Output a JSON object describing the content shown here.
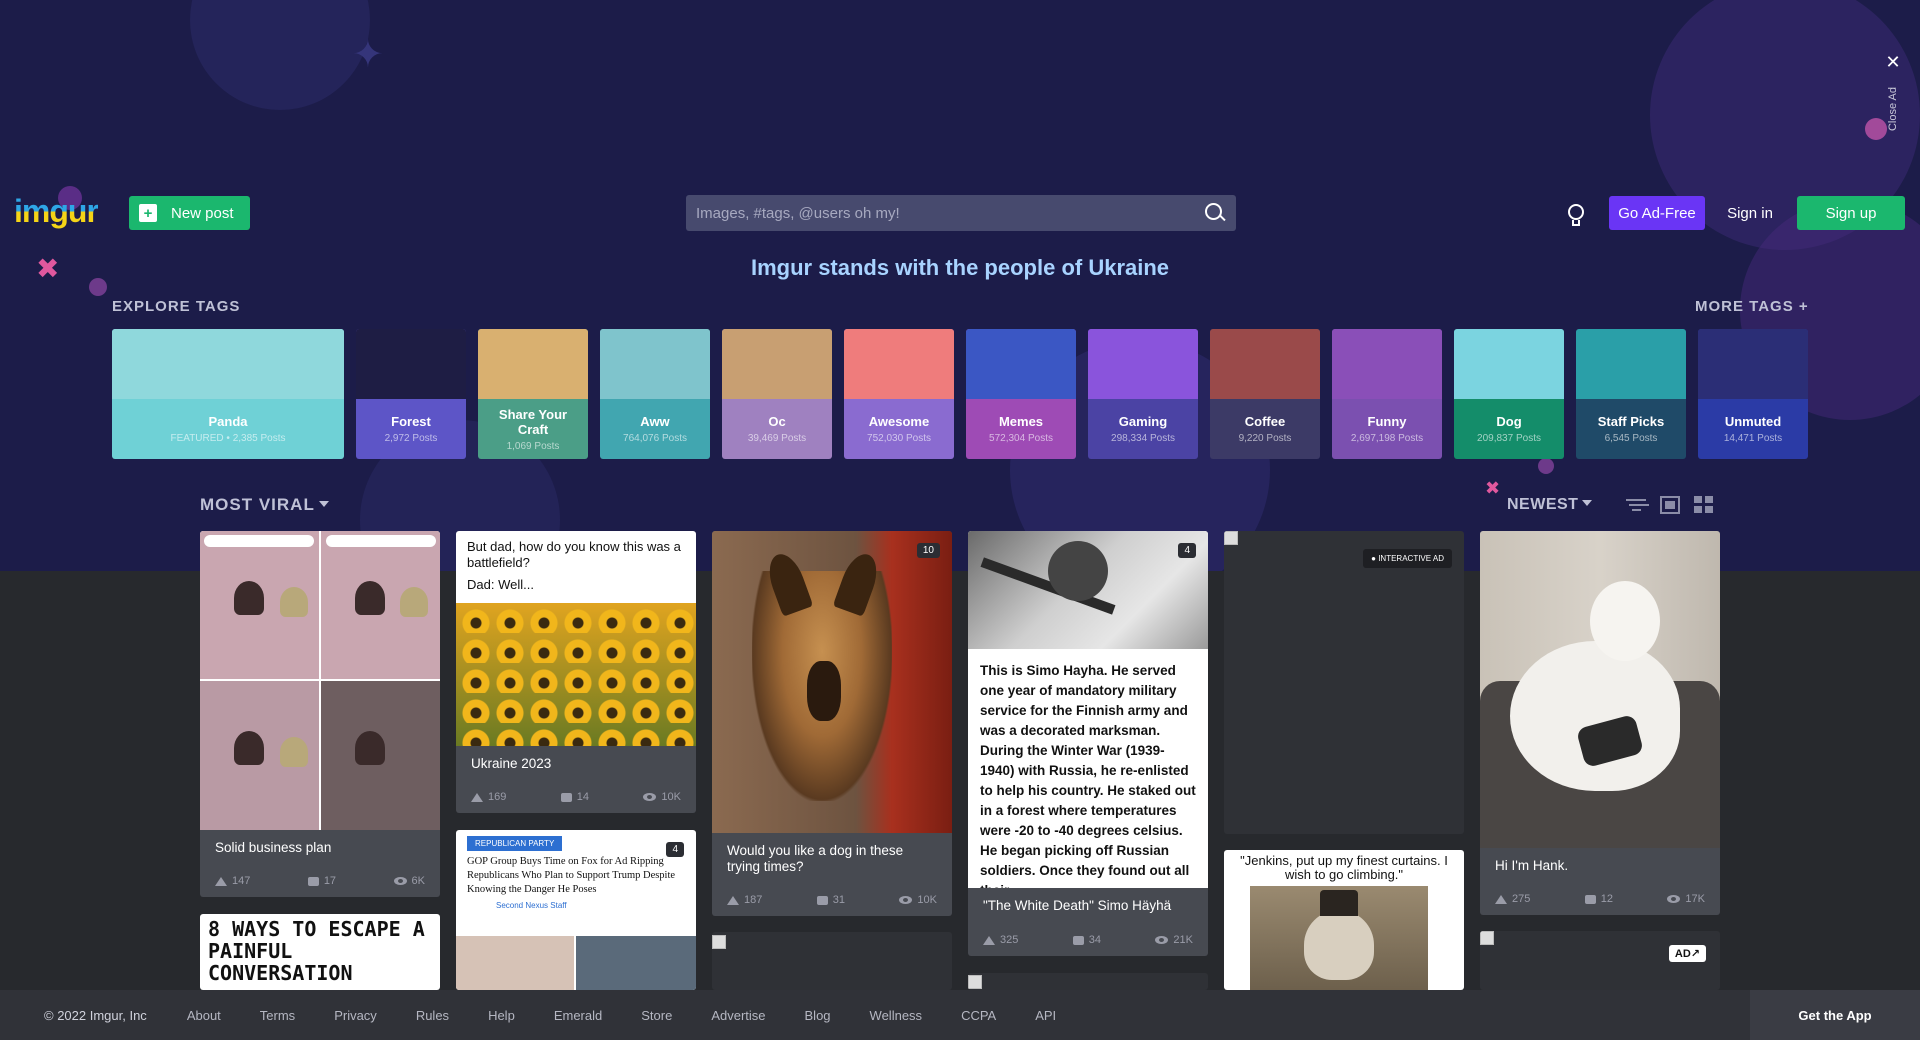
{
  "close_ad": {
    "label": "Close Ad"
  },
  "header": {
    "logo": "imgur",
    "new_post": "New post",
    "search_placeholder": "Images, #tags, @users oh my!",
    "go_ad_free": "Go Ad-Free",
    "sign_in": "Sign in",
    "sign_up": "Sign up"
  },
  "banner": {
    "text": "Imgur stands with the people of Ukraine"
  },
  "explore": {
    "title": "EXPLORE TAGS",
    "more": "MORE TAGS +",
    "tags": [
      {
        "name": "Panda",
        "posts": "FEATURED • 2,385 Posts",
        "color": "#6fd1d6",
        "art": "#8fd8dc"
      },
      {
        "name": "Forest",
        "posts": "2,972 Posts",
        "color": "#5d55c7",
        "art": "#1e1d44"
      },
      {
        "name": "Share Your Craft",
        "posts": "1,069 Posts",
        "color": "#4b9e87",
        "art": "#d9b070"
      },
      {
        "name": "Aww",
        "posts": "764,076 Posts",
        "color": "#41a6b0",
        "art": "#7fc4cc"
      },
      {
        "name": "Oc",
        "posts": "39,469 Posts",
        "color": "#9f81c0",
        "art": "#c89f72"
      },
      {
        "name": "Awesome",
        "posts": "752,030 Posts",
        "color": "#8a6bd0",
        "art": "#ef7c7c"
      },
      {
        "name": "Memes",
        "posts": "572,304 Posts",
        "color": "#9e4bb5",
        "art": "#3b57c4"
      },
      {
        "name": "Gaming",
        "posts": "298,334 Posts",
        "color": "#4b43a4",
        "art": "#8a54dc"
      },
      {
        "name": "Coffee",
        "posts": "9,220 Posts",
        "color": "#3c3a66",
        "art": "#9a4a4a"
      },
      {
        "name": "Funny",
        "posts": "2,697,198 Posts",
        "color": "#7b50b0",
        "art": "#8a4fb8"
      },
      {
        "name": "Dog",
        "posts": "209,837 Posts",
        "color": "#148d6a",
        "art": "#7bd4e0"
      },
      {
        "name": "Staff Picks",
        "posts": "6,545 Posts",
        "color": "#1f4a68",
        "art": "#2a9fa8"
      },
      {
        "name": "Unmuted",
        "posts": "14,471 Posts",
        "color": "#2b3ba6",
        "art": "#2b2e76"
      }
    ]
  },
  "viral": {
    "label": "MOST VIRAL",
    "sort": "NEWEST"
  },
  "posts": [
    {
      "title": "Solid business plan",
      "ups": "147",
      "comments": "17",
      "views": "6K"
    },
    {
      "title": "Ukraine 2023",
      "ups": "169",
      "comments": "14",
      "views": "10K",
      "img_text": "But dad, how do you know this was a battlefield?",
      "img_text2": "Dad: Well..."
    },
    {
      "title": "Would you like a dog in these trying times?",
      "ups": "187",
      "comments": "31",
      "views": "10K",
      "badge": "10"
    },
    {
      "title": "\"The White Death\" Simo Häyhä",
      "ups": "325",
      "comments": "34",
      "views": "21K",
      "badge": "4",
      "img_text": "This is Simo Hayha. He served one year of mandatory military service for the Finnish army and was a decorated marksman. During the Winter War (1939-1940) with Russia, he re-enlisted to help his country. He staked out in a forest where temperatures were -20 to -40 degrees celsius. He began picking off Russian soldiers. Once they found out all their"
    },
    {
      "title": "Hi I'm Hank.",
      "ups": "275",
      "comments": "12",
      "views": "17K"
    }
  ],
  "ad_card": {
    "label": "INTERACTIVE AD",
    "ad": "AD↗"
  },
  "extra": {
    "comic2": "8 WAYS TO ESCAPE A PAINFUL CONVERSATION",
    "news_tag": "REPUBLICAN PARTY",
    "news_headline": "GOP Group Buys Time on Fox for Ad Ripping Republicans Who Plan to Support Trump Despite Knowing the Danger He Poses",
    "news_badge": "4",
    "news_source": "Second Nexus Staff",
    "cat_quote": "\"Jenkins, put up my finest curtains. I wish to go climbing.\""
  },
  "footer": {
    "copyright": "© 2022 Imgur, Inc",
    "links": [
      "About",
      "Terms",
      "Privacy",
      "Rules",
      "Help",
      "Emerald",
      "Store",
      "Advertise",
      "Blog",
      "Wellness",
      "CCPA",
      "API"
    ],
    "get_app": "Get the App"
  }
}
